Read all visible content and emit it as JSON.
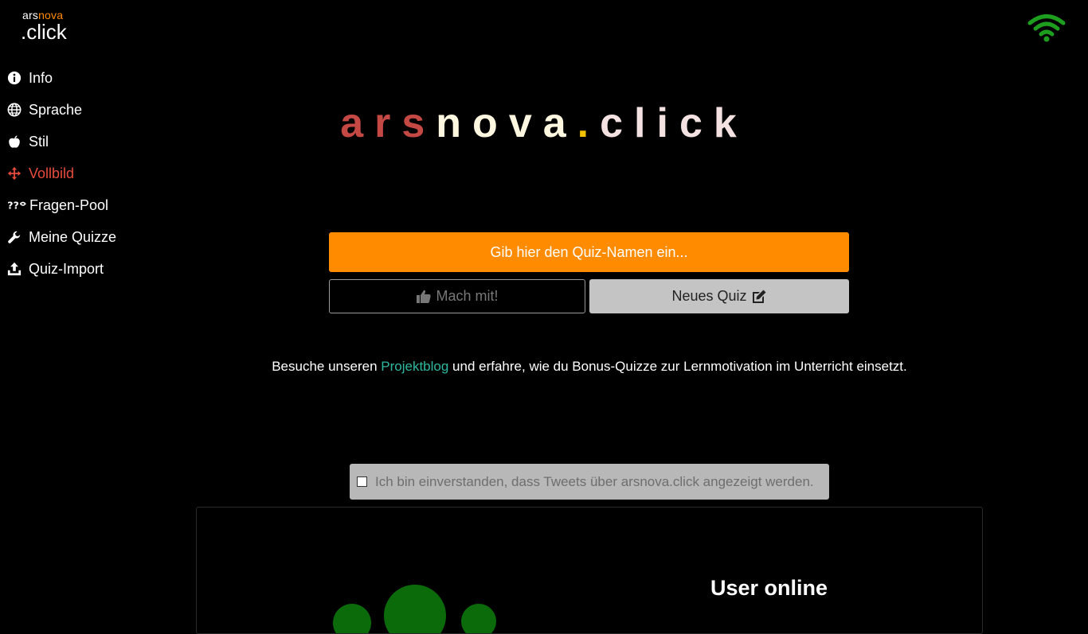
{
  "header": {
    "logo_top_ars": "ars",
    "logo_top_nova": "nova",
    "logo_bottom": ".click",
    "status_icon": "wifi-icon",
    "status_color": "#1e9e1e"
  },
  "sidebar": {
    "items": [
      {
        "label": "Info",
        "icon": "info-icon"
      },
      {
        "label": "Sprache",
        "icon": "globe-icon"
      },
      {
        "label": "Stil",
        "icon": "apple-icon"
      },
      {
        "label": "Vollbild",
        "icon": "move-arrows-icon",
        "active": true
      },
      {
        "label": "Fragen-Pool",
        "icon": "question-pool-icon"
      },
      {
        "label": "Meine Quizze",
        "icon": "wrench-icon"
      },
      {
        "label": "Quiz-Import",
        "icon": "upload-icon"
      }
    ]
  },
  "brand": {
    "ars": "ars",
    "nova": "nova",
    "dot": ".",
    "click": "click"
  },
  "quiz": {
    "placeholder": "Gib hier den Quiz-Namen ein...",
    "join_label": "Mach mit!",
    "new_label": "Neues Quiz"
  },
  "blog": {
    "prefix": "Besuche unseren ",
    "link": "Projektblog",
    "suffix": " und erfahre, wie du Bonus-Quizze zur Lernmotivation im Unterricht einsetzt."
  },
  "consent": {
    "label": "Ich bin einverstanden, dass Tweets über arsnova.click angezeigt werden."
  },
  "users": {
    "title": "User online"
  },
  "colors": {
    "accent_orange": "#ff8c00",
    "active_red": "#e64b3c",
    "link_teal": "#2fb8a0",
    "bubble_green": "#0b6b0b"
  }
}
